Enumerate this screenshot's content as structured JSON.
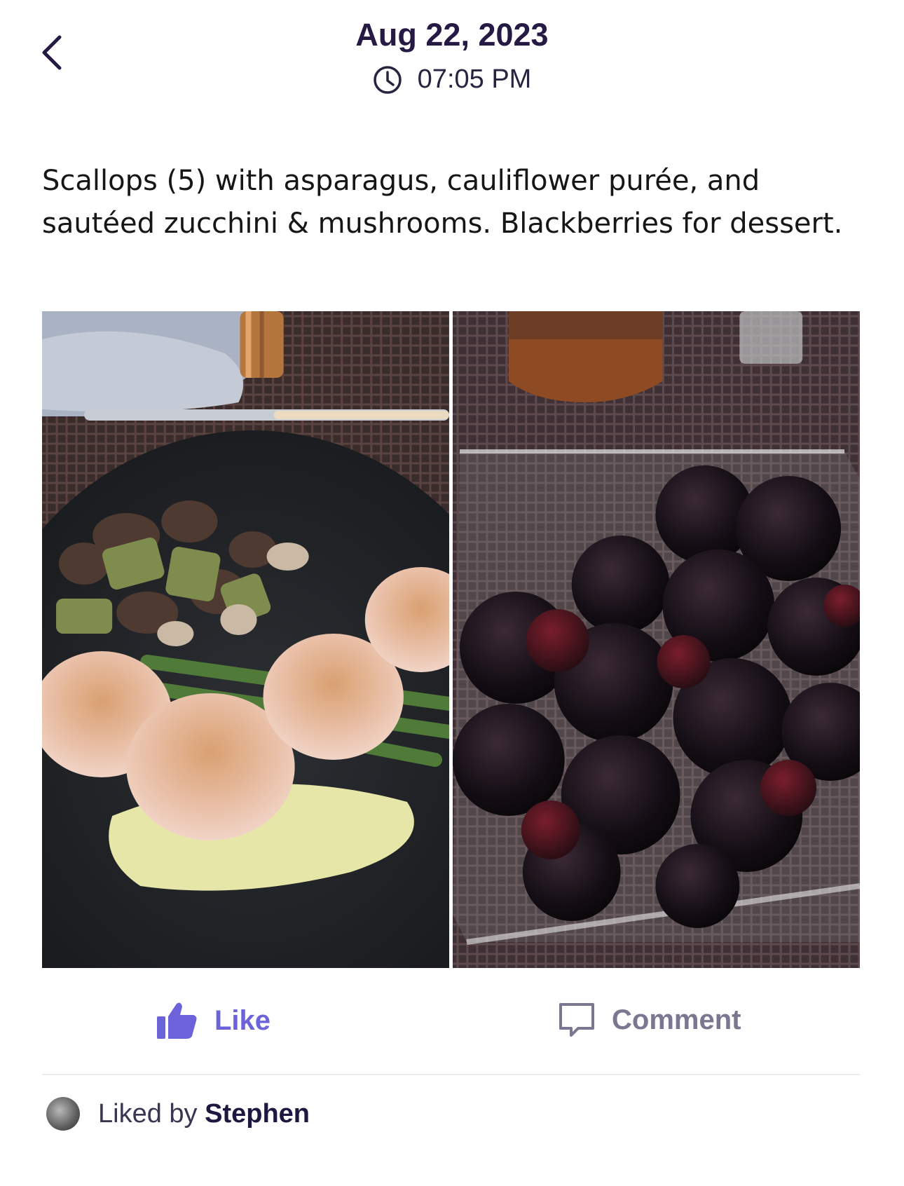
{
  "header": {
    "back_icon": "chevron-left-icon",
    "date": "Aug 22, 2023",
    "time_icon": "clock-icon",
    "time": "07:05 PM"
  },
  "post": {
    "description": "Scallops (5) with asparagus, cauliflower purée, and sautéed zucchini & mushrooms. Blackberries for dessert.",
    "photos": [
      {
        "name": "scallops-photo"
      },
      {
        "name": "blackberries-photo"
      }
    ]
  },
  "actions": {
    "like_label": "Like",
    "like_icon": "thumbs-up-icon",
    "like_color": "#6c63db",
    "comment_label": "Comment",
    "comment_icon": "speech-bubble-icon",
    "comment_color": "#7a7791"
  },
  "likes": {
    "prefix": "Liked by",
    "name": "Stephen"
  },
  "colors": {
    "title": "#241a44",
    "accent": "#6c63db"
  }
}
